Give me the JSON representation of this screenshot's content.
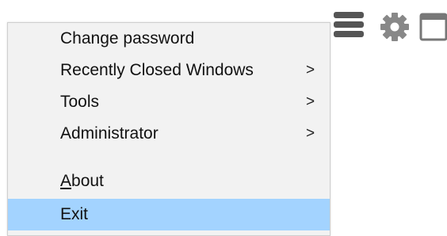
{
  "toolbar": {
    "icons": [
      "hamburger-menu-icon",
      "gear-icon",
      "window-icon"
    ],
    "icon_color": "#555555"
  },
  "menu": {
    "items": [
      {
        "label": "Change password",
        "has_submenu": false
      },
      {
        "label": "Recently Closed Windows",
        "has_submenu": true,
        "arrow": ">"
      },
      {
        "label": "Tools",
        "has_submenu": true,
        "arrow": ">"
      },
      {
        "label": "Administrator",
        "has_submenu": true,
        "arrow": ">"
      },
      {
        "label_accel": "A",
        "label_rest": "bout",
        "has_submenu": false
      },
      {
        "label": "Exit",
        "has_submenu": false,
        "selected": true
      }
    ],
    "selected_color": "#a3d3ff",
    "background_color": "#f2f2f2"
  }
}
